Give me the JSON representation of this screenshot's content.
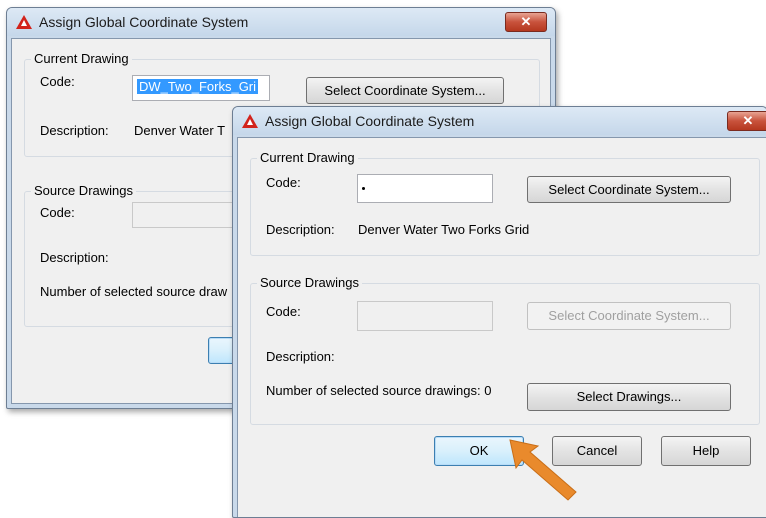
{
  "back_dialog": {
    "title": "Assign Global Coordinate System",
    "close_label": "✕",
    "current_drawing": {
      "legend": "Current Drawing",
      "code_label": "Code:",
      "code_value": "DW_Two_Forks_Gri",
      "select_button": "Select Coordinate System...",
      "description_label": "Description:",
      "description_value": "Denver Water T"
    },
    "source_drawings": {
      "legend": "Source Drawings",
      "code_label": "Code:",
      "description_label": "Description:",
      "count_label": "Number of selected source draw"
    }
  },
  "front_dialog": {
    "title": "Assign Global Coordinate System",
    "close_label": "✕",
    "current_drawing": {
      "legend": "Current Drawing",
      "code_label": "Code:",
      "code_value": "",
      "select_button": "Select Coordinate System...",
      "description_label": "Description:",
      "description_value": "Denver Water Two Forks Grid"
    },
    "source_drawings": {
      "legend": "Source Drawings",
      "code_label": "Code:",
      "code_value": "",
      "select_button": "Select Coordinate System...",
      "description_label": "Description:",
      "count_label": "Number of selected source drawings: 0",
      "select_drawings_button": "Select Drawings..."
    },
    "buttons": {
      "ok": "OK",
      "cancel": "Cancel",
      "help": "Help"
    }
  },
  "colors": {
    "app_icon": "#d2231b",
    "callout_arrow": "#e98a2c"
  }
}
